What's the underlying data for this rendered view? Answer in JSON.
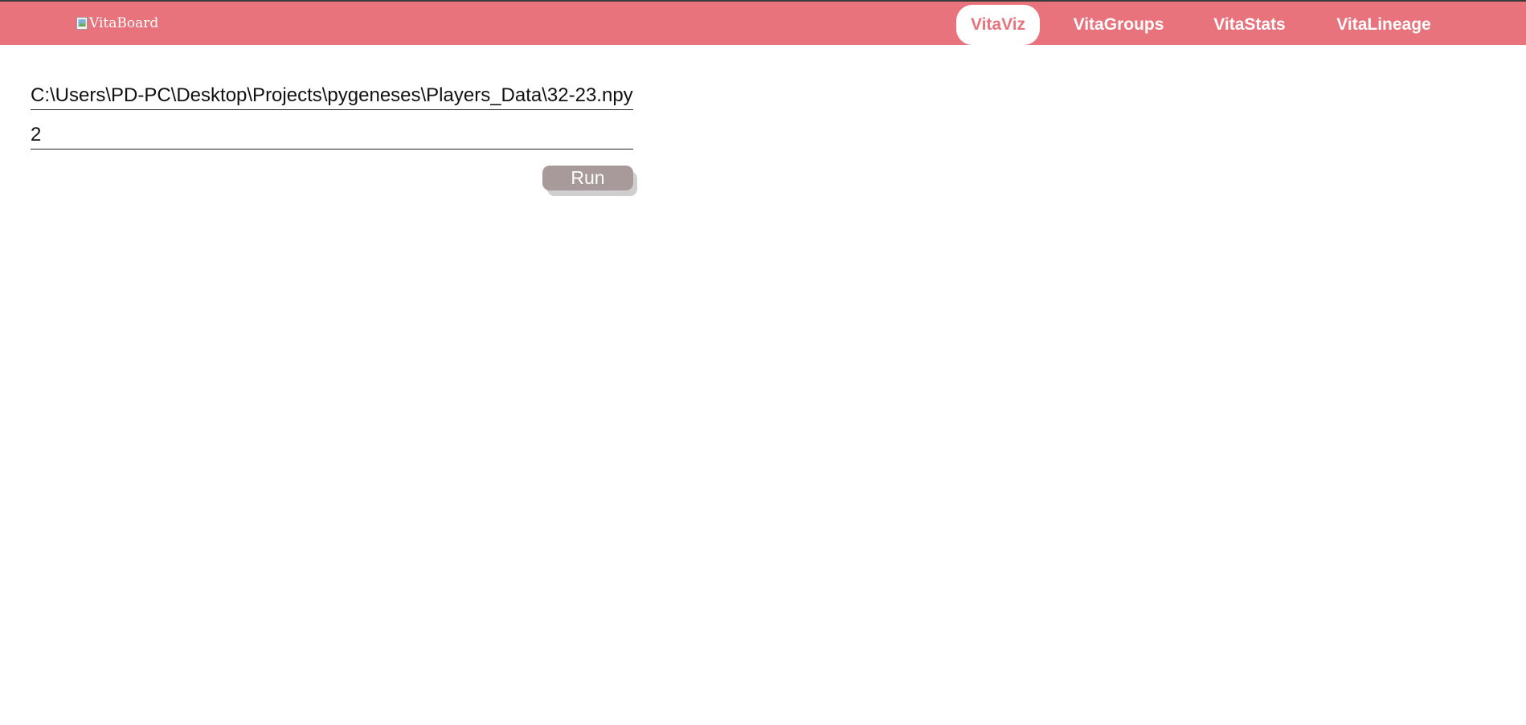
{
  "header": {
    "logo_alt": "VitaBoard",
    "background_color": "#e8737c",
    "nav": [
      {
        "label": "VitaViz",
        "active": true
      },
      {
        "label": "VitaGroups",
        "active": false
      },
      {
        "label": "VitaStats",
        "active": false
      },
      {
        "label": "VitaLineage",
        "active": false
      }
    ]
  },
  "form": {
    "file_path_value": "C:\\Users\\PD-PC\\Desktop\\Projects\\pygeneses\\Players_Data\\32-23.npy",
    "number_value": "2",
    "run_label": "Run",
    "run_button_color": "#a89a9a"
  }
}
